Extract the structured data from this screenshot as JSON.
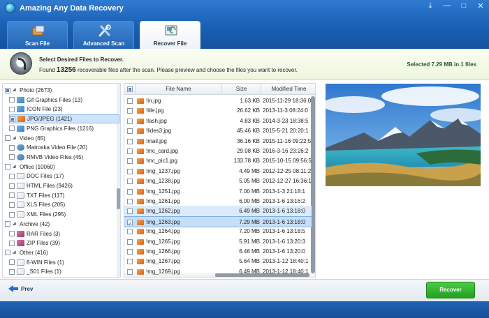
{
  "window": {
    "title": "Amazing Any Data Recovery",
    "controls": [
      "⤓",
      "—",
      "□",
      "✕"
    ]
  },
  "tabs": [
    {
      "label": "Scan File",
      "icon": "scan-file-icon"
    },
    {
      "label": "Advanced Scan",
      "icon": "tools-icon"
    },
    {
      "label": "Recover File",
      "icon": "recover-file-icon",
      "active": true
    }
  ],
  "info": {
    "heading": "Select Desired Files to Recover.",
    "found_prefix": "Found",
    "found_count": "13256",
    "found_suffix": "recoverable files after the scan. Please preview and choose the files you want to recover.",
    "selected": "Selected 7.29 MB in 1 files"
  },
  "tree": [
    {
      "label": "Photo (2673)",
      "level": 0,
      "check": "part",
      "twisty": "◢"
    },
    {
      "label": "Gif Graphics Files (13)",
      "level": 1,
      "check": "off",
      "icon": "img"
    },
    {
      "label": "ICON File (23)",
      "level": 1,
      "check": "off",
      "icon": "img"
    },
    {
      "label": "JPG/JPEG (1421)",
      "level": 1,
      "check": "part",
      "icon": "jpg",
      "selected": true
    },
    {
      "label": "PNG Graphics Files (1216)",
      "level": 1,
      "check": "off",
      "icon": "img"
    },
    {
      "label": "Video (65)",
      "level": 0,
      "check": "off",
      "twisty": "◢"
    },
    {
      "label": "Matroska Video File (20)",
      "level": 1,
      "check": "off",
      "icon": "vid"
    },
    {
      "label": "RMVB Video Files (45)",
      "level": 1,
      "check": "off",
      "icon": "vid"
    },
    {
      "label": "Office (10060)",
      "level": 0,
      "check": "off",
      "twisty": "◢"
    },
    {
      "label": "DOC Files (17)",
      "level": 1,
      "check": "off",
      "icon": "doc"
    },
    {
      "label": "HTML Files (9426)",
      "level": 1,
      "check": "off",
      "icon": "doc"
    },
    {
      "label": "TXT Files (117)",
      "level": 1,
      "check": "off",
      "icon": "doc"
    },
    {
      "label": "XLS Files (205)",
      "level": 1,
      "check": "off",
      "icon": "doc"
    },
    {
      "label": "XML Files (295)",
      "level": 1,
      "check": "off",
      "icon": "doc"
    },
    {
      "label": "Archive (42)",
      "level": 0,
      "check": "off",
      "twisty": "◢"
    },
    {
      "label": "RAR Files (3)",
      "level": 1,
      "check": "off",
      "icon": "zip"
    },
    {
      "label": "ZIP Files (39)",
      "level": 1,
      "check": "off",
      "icon": "zip"
    },
    {
      "label": "Other (416)",
      "level": 0,
      "check": "off",
      "twisty": "◢"
    },
    {
      "label": "8-WIN Files (1)",
      "level": 1,
      "check": "off",
      "icon": "doc"
    },
    {
      "label": "_S01 Files (1)",
      "level": 1,
      "check": "off",
      "icon": "doc"
    }
  ],
  "filelist": {
    "columns": {
      "name": "File Name",
      "size": "Size",
      "modified": "Modified Time"
    },
    "rows": [
      {
        "name": "!in.jpg",
        "size": "1.63 KB",
        "modified": "2015-11-29 18:36:0"
      },
      {
        "name": "!itle.jpg",
        "size": "26.62 KB",
        "modified": "2013-11-3 08:24:0"
      },
      {
        "name": "!lash.jpg",
        "size": "4.83 KB",
        "modified": "2014-3-23 18:38:5"
      },
      {
        "name": "!lides3.jpg",
        "size": "45.46 KB",
        "modified": "2015-5-21 20:20:1"
      },
      {
        "name": "!mail.jpg",
        "size": "36.16 KB",
        "modified": "2015-11-16 09:22:5"
      },
      {
        "name": "!mc_card.jpg",
        "size": "29.08 KB",
        "modified": "2016-3-16 23:26:2"
      },
      {
        "name": "!mc_pic1.jpg",
        "size": "133.78 KB",
        "modified": "2015-10-15 09:56:5"
      },
      {
        "name": "!mg_1237.jpg",
        "size": "4.49 MB",
        "modified": "2012-12-25 08:11:2"
      },
      {
        "name": "!mg_1238.jpg",
        "size": "5.05 MB",
        "modified": "2012-12-27 16:36:1"
      },
      {
        "name": "!mg_1251.jpg",
        "size": "7.00 MB",
        "modified": "2013-1-3 21:18:1"
      },
      {
        "name": "!mg_1261.jpg",
        "size": "6.00 MB",
        "modified": "2013-1-6 13:16:2"
      },
      {
        "name": "!mg_1262.jpg",
        "size": "6.49 MB",
        "modified": "2013-1-6 13:18:0",
        "highlight": true
      },
      {
        "name": "!mg_1263.jpg",
        "size": "7.29 MB",
        "modified": "2013-1-6 13:18:0",
        "selected": true
      },
      {
        "name": "!mg_1264.jpg",
        "size": "7.20 MB",
        "modified": "2013-1-6 13:18:5"
      },
      {
        "name": "!mg_1265.jpg",
        "size": "5.91 MB",
        "modified": "2013-1-6 13:20:3"
      },
      {
        "name": "!mg_1266.jpg",
        "size": "6.46 MB",
        "modified": "2013-1-6 13:20:0"
      },
      {
        "name": "!mg_1267.jpg",
        "size": "5.64 MB",
        "modified": "2013-1-12 18:40:1"
      },
      {
        "name": "!mg_1269.jpg",
        "size": "6.49 MB",
        "modified": "2013-1-12 18:40:1"
      }
    ]
  },
  "bottom": {
    "prev_label": "Prev",
    "recover_label": "Recover"
  },
  "colors": {
    "header_blue": "#1a5fb4",
    "recover_green": "#21a11d",
    "selection_blue": "#c6def8"
  }
}
